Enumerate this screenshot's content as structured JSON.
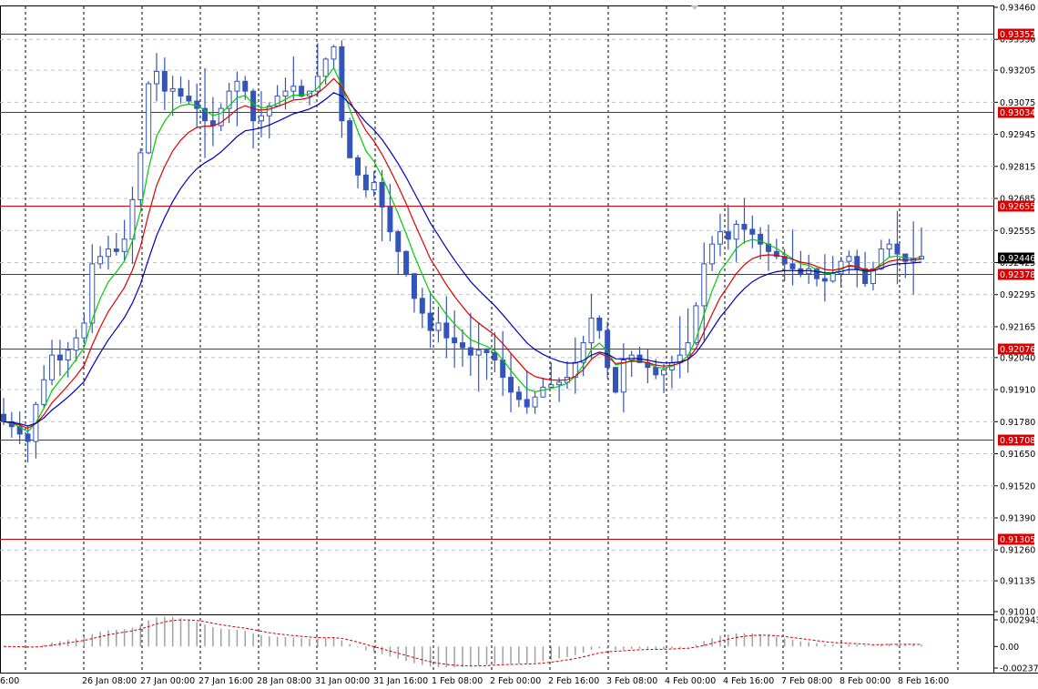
{
  "chart_data": {
    "type": "candlestick",
    "price_axis": {
      "min": 0.9101,
      "max": 0.9346,
      "ticks": [
        "0.93460",
        "0.93330",
        "0.93205",
        "0.93075",
        "0.92945",
        "0.92815",
        "0.92685",
        "0.92555",
        "0.92425",
        "0.92295",
        "0.92165",
        "0.92040",
        "0.91910",
        "0.91780",
        "0.91650",
        "0.91520",
        "0.91390",
        "0.91260",
        "0.91135",
        "0.91010"
      ]
    },
    "time_axis": {
      "labels": [
        "6:00",
        "26 Jan 08:00",
        "27 Jan 00:00",
        "27 Jan 16:00",
        "28 Jan 08:00",
        "31 Jan 00:00",
        "31 Jan 16:00",
        "1 Feb 08:00",
        "2 Feb 00:00",
        "2 Feb 16:00",
        "3 Feb 08:00",
        "4 Feb 00:00",
        "4 Feb 16:00",
        "7 Feb 08:00",
        "8 Feb 00:00",
        "8 Feb 16:00"
      ]
    },
    "horizontal_levels": [
      {
        "label": "0.93352",
        "value": 0.93352
      },
      {
        "label": "0.93034",
        "value": 0.93034
      },
      {
        "label": "0.92655",
        "value": 0.92655
      },
      {
        "label": "0.92378",
        "value": 0.92378
      },
      {
        "label": "0.92076",
        "value": 0.92076
      },
      {
        "label": "0.91708",
        "value": 0.91708
      },
      {
        "label": "0.91305",
        "value": 0.91305
      }
    ],
    "current_price": {
      "label": "0.92446",
      "value": 0.92446
    },
    "close_series": [
      0.9178,
      0.9176,
      0.9173,
      0.917,
      0.9185,
      0.9195,
      0.9205,
      0.9203,
      0.9207,
      0.9212,
      0.9218,
      0.9242,
      0.9245,
      0.9248,
      0.9247,
      0.9252,
      0.9268,
      0.9287,
      0.9315,
      0.932,
      0.9312,
      0.9313,
      0.931,
      0.9308,
      0.9305,
      0.93,
      0.9298,
      0.9305,
      0.9312,
      0.9316,
      0.9312,
      0.93,
      0.9302,
      0.9306,
      0.931,
      0.9312,
      0.9314,
      0.931,
      0.9312,
      0.9318,
      0.9325,
      0.933,
      0.93,
      0.9285,
      0.9278,
      0.9272,
      0.9275,
      0.9265,
      0.9255,
      0.9247,
      0.9238,
      0.9228,
      0.9222,
      0.9215,
      0.9218,
      0.9212,
      0.921,
      0.9208,
      0.9205,
      0.9207,
      0.9206,
      0.9203,
      0.9196,
      0.919,
      0.9187,
      0.9184,
      0.9188,
      0.9192,
      0.9193,
      0.9194,
      0.9196,
      0.9202,
      0.921,
      0.922,
      0.9215,
      0.92,
      0.919,
      0.9203,
      0.9205,
      0.9202,
      0.92,
      0.9197,
      0.9199,
      0.9202,
      0.9205,
      0.921,
      0.9225,
      0.9242,
      0.925,
      0.9255,
      0.9252,
      0.9258,
      0.9256,
      0.9254,
      0.925,
      0.9247,
      0.9245,
      0.9242,
      0.924,
      0.9238,
      0.924,
      0.9236,
      0.9235,
      0.9238,
      0.9243,
      0.9245,
      0.924,
      0.9234,
      0.924,
      0.9248,
      0.925,
      0.9246,
      0.9243,
      0.9244,
      0.9245
    ],
    "moving_averages": [
      {
        "color": "#00cc00",
        "period": "fast"
      },
      {
        "color": "#dd0000",
        "period": "medium"
      },
      {
        "color": "#0000bb",
        "period": "slow"
      }
    ],
    "oscillator": {
      "type": "histogram",
      "ticks": [
        "0.002943",
        "0.00",
        "-0.002378"
      ],
      "max": 0.002943,
      "min": -0.002378
    }
  },
  "colors": {
    "candle": "#3355bb",
    "level_line": "#dd0000",
    "level_label_bg": "#dd0000",
    "current_label_bg": "#000000",
    "grid": "#c0c0c0",
    "signal": "#cc0000",
    "histogram": "#a0a0a0"
  }
}
